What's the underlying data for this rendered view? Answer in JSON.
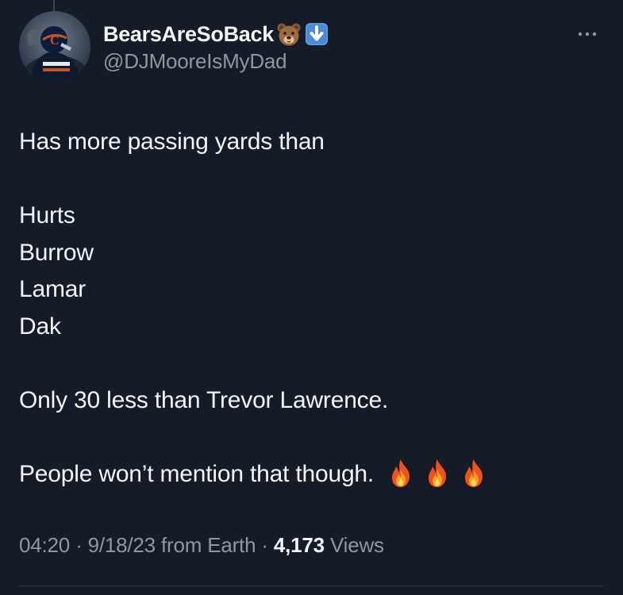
{
  "author": {
    "display_name": "BearsAreSoBack",
    "handle": "@DJMooreIsMyDad",
    "name_emojis": [
      "bear-face-icon",
      "down-arrow-icon"
    ]
  },
  "tweet": {
    "lines": {
      "l1": "Has more passing yards than",
      "l2": "Hurts",
      "l3": "Burrow",
      "l4": "Lamar",
      "l5": "Dak",
      "l6": "Only 30 less than Trevor Lawrence.",
      "l7": "People won’t mention that though."
    },
    "trailing_emojis": [
      "fire-icon",
      "fire-icon",
      "fire-icon"
    ]
  },
  "meta": {
    "time": "04:20",
    "sep1": " · ",
    "date": "9/18/23",
    "source": " from Earth",
    "sep2": " · ",
    "views_count": "4,173",
    "views_label": " Views"
  },
  "colors": {
    "background": "#151c27",
    "text": "#f4f6f8",
    "secondary": "#8b98a5"
  }
}
